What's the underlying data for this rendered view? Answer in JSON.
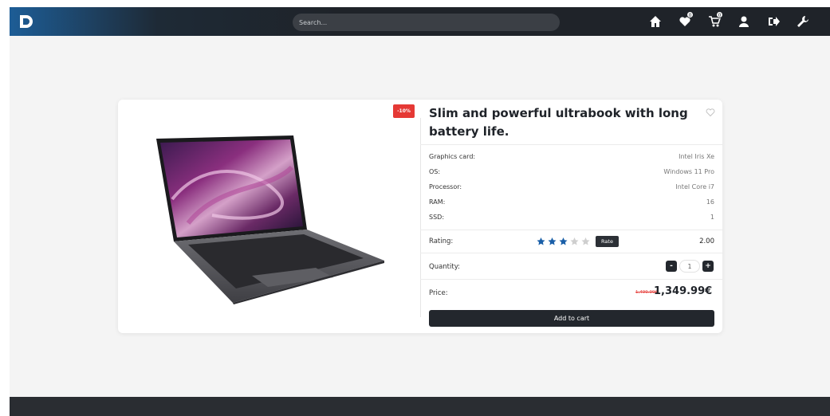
{
  "navbar": {
    "search_placeholder": "Search...",
    "icons": [
      "home-icon",
      "wishlist-heart-icon",
      "cart-icon",
      "user-icon",
      "logout-icon",
      "settings-wrench-icon"
    ],
    "wishlist_count": "0",
    "cart_count": "0"
  },
  "product": {
    "discount_badge": "-10%",
    "title": "Slim and powerful ultrabook with long battery life.",
    "specs": [
      {
        "label": "Graphics card:",
        "value": "Intel Iris Xe"
      },
      {
        "label": "OS:",
        "value": "Windows 11 Pro"
      },
      {
        "label": "Processor:",
        "value": "Intel Core i7"
      },
      {
        "label": "RAM:",
        "value": "16"
      },
      {
        "label": "SSD:",
        "value": "1"
      }
    ],
    "rating_label": "Rating:",
    "rating_stars": 3,
    "rating_max": 5,
    "rate_button": "Rate",
    "rating_value": "2.00",
    "quantity_label": "Quantity:",
    "quantity_minus": "-",
    "quantity_value": "1",
    "quantity_plus": "+",
    "price_label": "Price:",
    "old_price": "1,499.99€",
    "new_price": "1,349.99€",
    "add_to_cart": "Add to cart"
  },
  "colors": {
    "accent_dark": "#23272d",
    "discount_red": "#e53935",
    "star_blue": "#1a5fa8",
    "star_grey": "#cfcfcf"
  }
}
